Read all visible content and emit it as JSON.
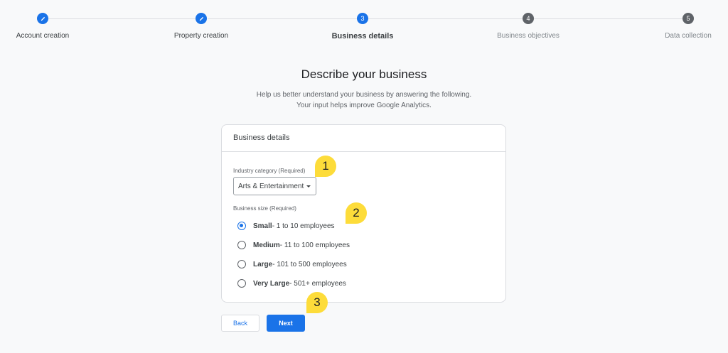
{
  "stepper": {
    "steps": [
      {
        "label": "Account creation",
        "number": "",
        "state": "done"
      },
      {
        "label": "Property creation",
        "number": "",
        "state": "done"
      },
      {
        "label": "Business details",
        "number": "3",
        "state": "active"
      },
      {
        "label": "Business objectives",
        "number": "4",
        "state": "todo"
      },
      {
        "label": "Data collection",
        "number": "5",
        "state": "todo"
      }
    ]
  },
  "page": {
    "title": "Describe your business",
    "subtitle_line1": "Help us better understand your business by answering the following.",
    "subtitle_line2": "Your input helps improve Google Analytics."
  },
  "card": {
    "title": "Business details",
    "industry_label": "Industry category (Required)",
    "industry_value": "Arts & Entertainment",
    "size_label": "Business size (Required)",
    "size_options": [
      {
        "bold": "Small",
        "rest": " - 1 to 10 employees",
        "checked": true
      },
      {
        "bold": "Medium",
        "rest": " - 11 to 100 employees",
        "checked": false
      },
      {
        "bold": "Large",
        "rest": " - 101 to 500 employees",
        "checked": false
      },
      {
        "bold": "Very Large",
        "rest": " - 501+ employees",
        "checked": false
      }
    ]
  },
  "buttons": {
    "back": "Back",
    "next": "Next"
  },
  "callouts": [
    "1",
    "2",
    "3"
  ],
  "colors": {
    "accent": "#1a73e8",
    "callout": "#fddc3a"
  }
}
